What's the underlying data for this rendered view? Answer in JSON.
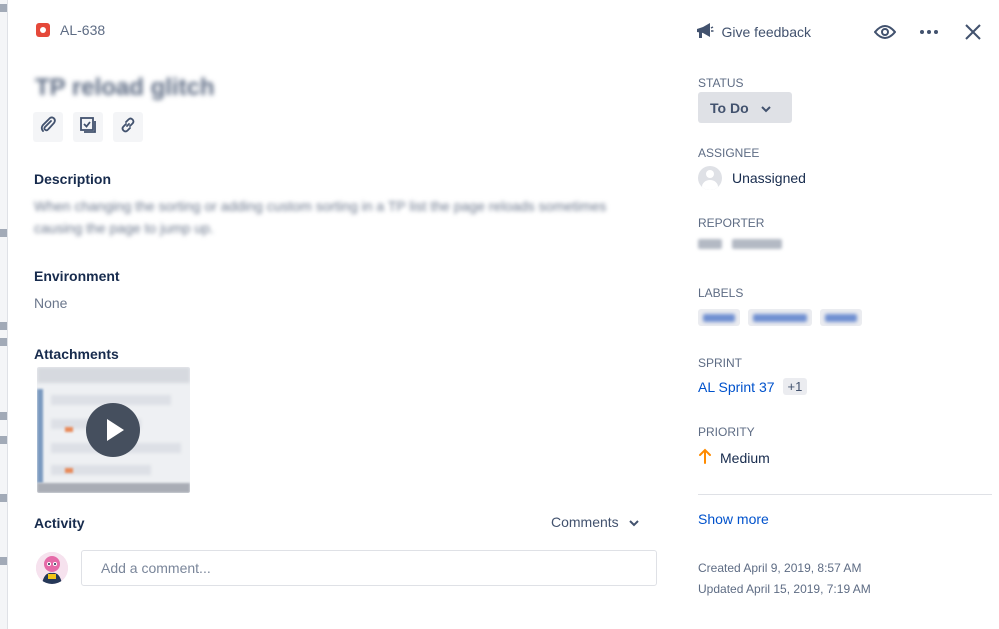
{
  "issue": {
    "key": "AL-638",
    "title": "TP reload glitch",
    "accent": "#e5493a"
  },
  "header": {
    "feedback_label": "Give feedback"
  },
  "sections": {
    "description_label": "Description",
    "description_text": "When changing the sorting or adding custom sorting in a TP list the page reloads sometimes causing the page to jump up.",
    "environment_label": "Environment",
    "environment_value": "None",
    "attachments_label": "Attachments",
    "activity_label": "Activity"
  },
  "activity": {
    "filter_label": "Comments",
    "comment_placeholder": "Add a comment..."
  },
  "sidebar": {
    "status_label": "STATUS",
    "status_value": "To Do",
    "assignee_label": "ASSIGNEE",
    "assignee_value": "Unassigned",
    "reporter_label": "REPORTER",
    "labels_label": "LABELS",
    "sprint_label": "SPRINT",
    "sprint_value": "AL Sprint 37",
    "sprint_extra": "+1",
    "priority_label": "PRIORITY",
    "priority_value": "Medium",
    "priority_color": "#ff8b00",
    "show_more": "Show more",
    "created": "Created April 9, 2019, 8:57 AM",
    "updated": "Updated April 15, 2019, 7:19 AM"
  },
  "colors": {
    "link": "#0052cc",
    "text": "#172b4d",
    "muted": "#5e6c84"
  }
}
